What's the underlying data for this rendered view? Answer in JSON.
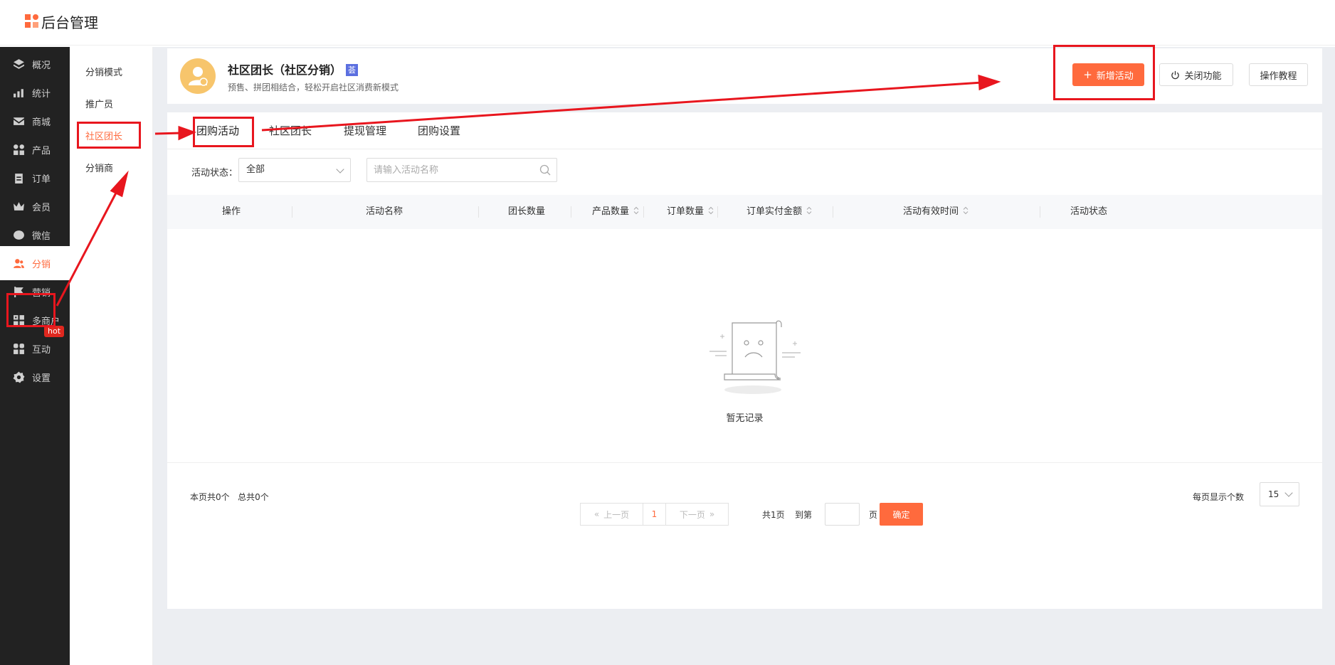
{
  "app": {
    "title": "后台管理"
  },
  "sidebar": {
    "items": [
      {
        "label": "概况",
        "icon": "layers-icon"
      },
      {
        "label": "统计",
        "icon": "stats-icon"
      },
      {
        "label": "商城",
        "icon": "mail-icon"
      },
      {
        "label": "产品",
        "icon": "grid-icon"
      },
      {
        "label": "订单",
        "icon": "clipboard-icon"
      },
      {
        "label": "会员",
        "icon": "crown-icon"
      },
      {
        "label": "微信",
        "icon": "chat-icon"
      },
      {
        "label": "分销",
        "icon": "users-icon",
        "active": true
      },
      {
        "label": "营销",
        "icon": "flag-icon"
      },
      {
        "label": "多商户",
        "icon": "store-icon"
      },
      {
        "label": "互动",
        "icon": "people-icon"
      },
      {
        "label": "设置",
        "icon": "gear-icon"
      }
    ],
    "hot_badge": "hot"
  },
  "submenu": {
    "items": [
      "分销模式",
      "推广员",
      "社区团长",
      "分销商"
    ],
    "active": "社区团长"
  },
  "header": {
    "title": "社区团长（社区分销）",
    "tag": "荟",
    "desc": "预售、拼团相结合，轻松开启社区消费新模式",
    "add_button": "新增活动",
    "close_button": "关闭功能",
    "tutorial_button": "操作教程"
  },
  "tabs": [
    "团购活动",
    "社区团长",
    "提现管理",
    "团购设置"
  ],
  "active_tab": "团购活动",
  "filter": {
    "status_label": "活动状态：",
    "status_value": "全部",
    "search_placeholder": "请输入活动名称"
  },
  "table": {
    "columns": [
      "操作",
      "活动名称",
      "团长数量",
      "产品数量",
      "订单数量",
      "订单实付金额",
      "活动有效时间",
      "活动状态"
    ],
    "empty_text": "暂无记录"
  },
  "footer": {
    "count_text": "本页共0个   总共0个",
    "prev_label": "上一页",
    "current_page": "1",
    "next_label": "下一页",
    "total_pages": "共1页",
    "goto_label": "到第",
    "page_unit": "页",
    "confirm_label": "确定",
    "per_page_label": "每页显示个数",
    "per_page_value": "15"
  },
  "colors": {
    "accent": "#ff6a3d",
    "sidebar_bg": "#222222",
    "annotation": "#e8161e"
  }
}
